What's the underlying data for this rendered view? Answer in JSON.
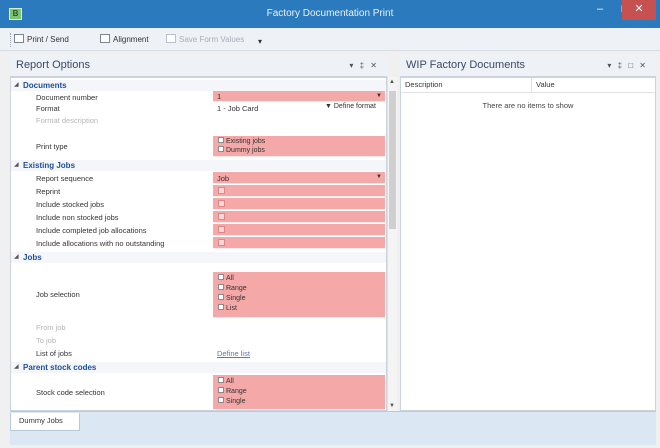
{
  "window": {
    "title": "Factory Documentation Print",
    "icon_letter": "B",
    "min_glyph": "–",
    "max_glyph": "□",
    "close_glyph": "✕"
  },
  "toolbar": {
    "print_send": "Print / Send",
    "alignment": "Alignment",
    "save_form_values": "Save Form Values",
    "more": "▾"
  },
  "report_options": {
    "title": "Report Options",
    "controls": "▾ ‡ ✕",
    "sections": {
      "documents": "Documents",
      "existing_jobs": "Existing Jobs",
      "jobs": "Jobs",
      "parent_stock_codes": "Parent stock codes"
    },
    "rows": {
      "document_number": {
        "label": "Document number",
        "value": "1"
      },
      "format": {
        "label": "Format",
        "value": "1 - Job Card",
        "button": "Define format"
      },
      "format_description": {
        "label": "Format description"
      },
      "print_type": {
        "label": "Print type",
        "options": [
          "Existing jobs",
          "Dummy jobs"
        ]
      },
      "report_sequence": {
        "label": "Report sequence",
        "value": "Job"
      },
      "reprint": {
        "label": "Reprint"
      },
      "include_stocked_jobs": {
        "label": "Include stocked jobs"
      },
      "include_non_stocked_jobs": {
        "label": "Include non stocked jobs"
      },
      "include_completed_job_allocations": {
        "label": "Include completed job allocations"
      },
      "include_allocations_no_outstanding": {
        "label": "Include allocations with no outstanding"
      },
      "job_selection": {
        "label": "Job selection",
        "options": [
          "All",
          "Range",
          "Single",
          "List"
        ]
      },
      "from_job": {
        "label": "From job"
      },
      "to_job": {
        "label": "To job"
      },
      "list_of_jobs": {
        "label": "List of jobs",
        "value": "Define list"
      },
      "stock_code_selection": {
        "label": "Stock code selection",
        "options": [
          "All",
          "Range",
          "Single"
        ]
      }
    }
  },
  "wip_panel": {
    "title": "WIP Factory Documents",
    "controls": "▾ ‡ □ ✕",
    "columns": [
      "Description",
      "Value"
    ],
    "empty_message": "There are no items to show"
  },
  "bottom_tabs": [
    "Dummy Jobs"
  ],
  "colors": {
    "title_bar": "#2a7abd",
    "required_field": "#f4a8a8",
    "section_header": "#1f4e9a",
    "close_button": "#c75050"
  }
}
